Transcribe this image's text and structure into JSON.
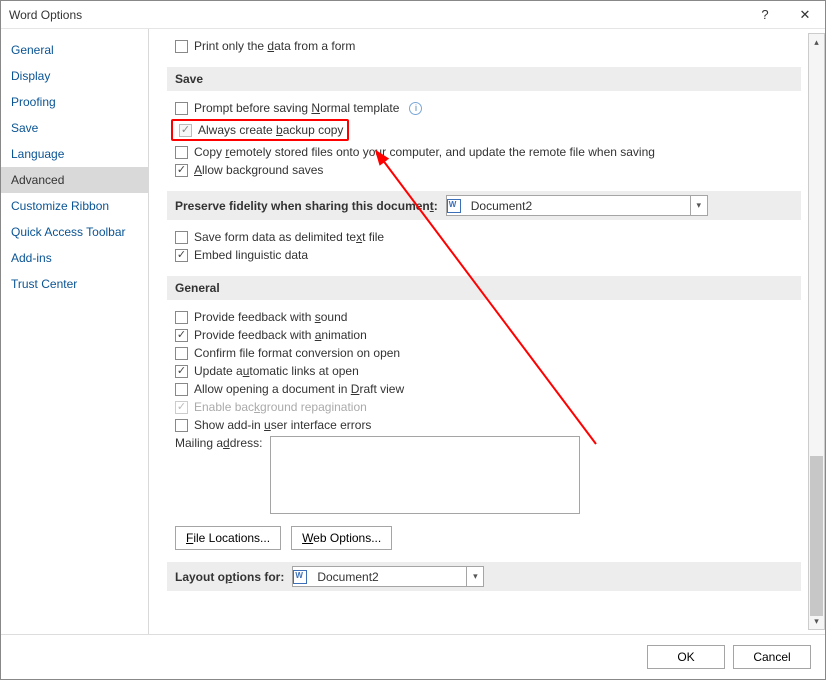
{
  "titlebar": {
    "title": "Word Options",
    "help": "?",
    "close": "✕"
  },
  "sidebar": {
    "items": [
      {
        "label": "General"
      },
      {
        "label": "Display"
      },
      {
        "label": "Proofing"
      },
      {
        "label": "Save"
      },
      {
        "label": "Language"
      },
      {
        "label": "Advanced",
        "selected": true
      },
      {
        "label": "Customize Ribbon"
      },
      {
        "label": "Quick Access Toolbar"
      },
      {
        "label": "Add-ins"
      },
      {
        "label": "Trust Center"
      }
    ]
  },
  "sections": {
    "print_only": {
      "pre": "Print only the ",
      "u": "d",
      "post": "ata from a form"
    },
    "save_head": "Save",
    "prompt_normal": {
      "pre": "Prompt before saving ",
      "u": "N",
      "post": "ormal template"
    },
    "backup_copy": {
      "pre": "Always create ",
      "u": "b",
      "post": "ackup copy"
    },
    "copy_remote": {
      "pre": "Copy ",
      "u": "r",
      "post": "emotely stored files onto your computer, and update the remote file when saving"
    },
    "bg_saves": {
      "pre": "",
      "u": "A",
      "post": "llow background saves"
    },
    "preserve_head": {
      "pre": "Preserve fidelity when sharing this documen",
      "u": "t",
      "post": ":"
    },
    "preserve_dd": "Document2",
    "save_delimited": {
      "pre": "Save form data as delimited te",
      "u": "x",
      "post": "t file"
    },
    "embed_ling": "Embed linguistic data",
    "general_head": "General",
    "feedback_sound": {
      "pre": "Provide feedback with ",
      "u": "s",
      "post": "ound"
    },
    "feedback_anim": {
      "pre": "Provide feedback with ",
      "u": "a",
      "post": "nimation"
    },
    "confirm_conv": "Confirm file format conversion on open",
    "update_links": {
      "pre": "Update a",
      "u": "u",
      "post": "tomatic links at open"
    },
    "draft_view": {
      "pre": "Allow opening a document in ",
      "u": "D",
      "post": "raft view"
    },
    "enable_repag": {
      "pre": "Enable bac",
      "u": "k",
      "post": "ground repagination"
    },
    "addin_errors": {
      "pre": "Show add-in ",
      "u": "u",
      "post": "ser interface errors"
    },
    "mailing_label": {
      "pre": "Mailing a",
      "u": "d",
      "post": "dress:"
    },
    "file_locations": {
      "u": "F",
      "post": "ile Locations..."
    },
    "web_options": {
      "pre": "",
      "u": "W",
      "post": "eb Options..."
    },
    "layout_head": {
      "pre": "Layout o",
      "u": "p",
      "post": "tions for:"
    },
    "layout_dd": "Document2"
  },
  "footer": {
    "ok": "OK",
    "cancel": "Cancel"
  }
}
